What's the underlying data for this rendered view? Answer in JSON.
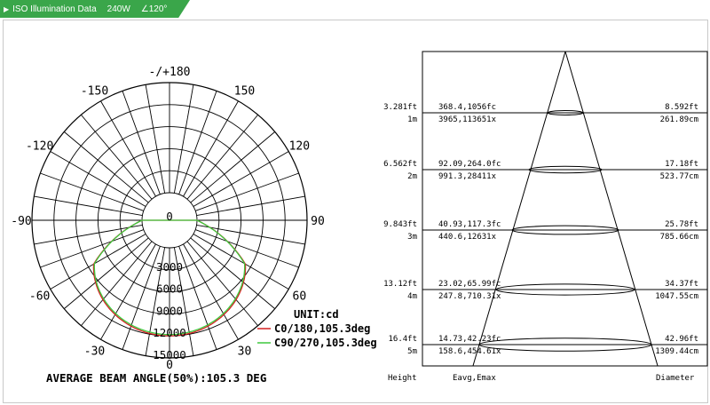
{
  "header": {
    "title": "ISO Illumination Data",
    "power": "240W",
    "angle": "∠120°"
  },
  "polar": {
    "angle_labels": [
      {
        "text": "-/+180",
        "deg": 180
      },
      {
        "text": "150",
        "deg": 150
      },
      {
        "text": "-150",
        "deg": -150
      },
      {
        "text": "120",
        "deg": 120
      },
      {
        "text": "-120",
        "deg": -120
      },
      {
        "text": "90",
        "deg": 90
      },
      {
        "text": "-90",
        "deg": -90
      },
      {
        "text": "60",
        "deg": 60
      },
      {
        "text": "-60",
        "deg": -60
      },
      {
        "text": "30",
        "deg": 30
      },
      {
        "text": "-30",
        "deg": -30
      },
      {
        "text": "0",
        "deg": 0
      }
    ],
    "ring_labels": [
      "0",
      "3000",
      "6000",
      "9000",
      "12000",
      "15000"
    ],
    "ring_max": 15000,
    "unit": "UNIT:cd",
    "beam_angle_text": "AVERAGE BEAM ANGLE(50%):105.3 DEG",
    "series": [
      {
        "name": "C0/180,105.3deg",
        "color": "#d42020",
        "scale": 1.0
      },
      {
        "name": "C90/270,105.3deg",
        "color": "#3ec93e",
        "scale": 0.985
      }
    ]
  },
  "cone": {
    "rows": [
      {
        "height_ft": "3.281ft",
        "height_m": "1m",
        "eavg_fc": "368.4,1056fc",
        "eavg_lx": "3965,113651x",
        "dia_ft": "8.592ft",
        "dia_m": "261.89cm"
      },
      {
        "height_ft": "6.562ft",
        "height_m": "2m",
        "eavg_fc": "92.09,264.0fc",
        "eavg_lx": "991.3,28411x",
        "dia_ft": "17.18ft",
        "dia_m": "523.77cm"
      },
      {
        "height_ft": "9.843ft",
        "height_m": "3m",
        "eavg_fc": "40.93,117.3fc",
        "eavg_lx": "440.6,12631x",
        "dia_ft": "25.78ft",
        "dia_m": "785.66cm"
      },
      {
        "height_ft": "13.12ft",
        "height_m": "4m",
        "eavg_fc": "23.02,65.99fc",
        "eavg_lx": "247.8,710.31x",
        "dia_ft": "34.37ft",
        "dia_m": "1047.55cm"
      },
      {
        "height_ft": "16.4ft",
        "height_m": "5m",
        "eavg_fc": "14.73,42.23fc",
        "eavg_lx": "158.6,454.61x",
        "dia_ft": "42.96ft",
        "dia_m": "1309.44cm"
      }
    ],
    "footer": {
      "height": "Height",
      "eavg": "Eavg,Emax",
      "diameter": "Diameter"
    }
  }
}
